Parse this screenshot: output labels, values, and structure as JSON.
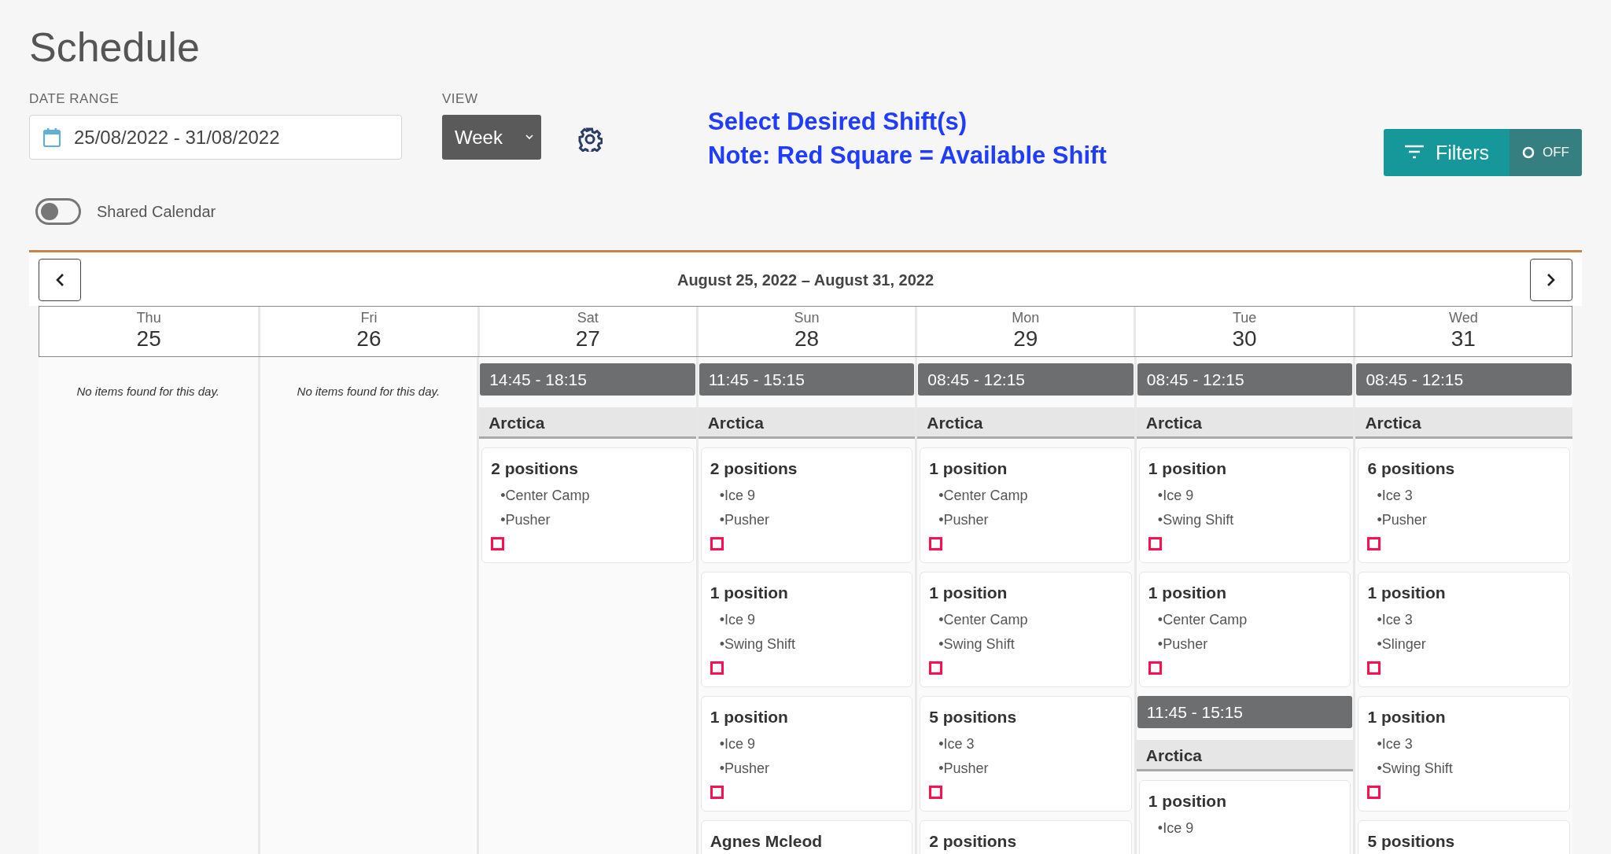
{
  "page": {
    "title": "Schedule"
  },
  "date_range": {
    "label": "DATE RANGE",
    "value": "25/08/2022 - 31/08/2022"
  },
  "view": {
    "label": "VIEW",
    "value": "Week"
  },
  "notice": [
    "Select Desired Shift(s)",
    "Note: Red Square = Available Shift"
  ],
  "filters": {
    "label": "Filters",
    "state_label": "OFF",
    "on": false
  },
  "shared_calendar": {
    "label": "Shared Calendar",
    "on": false
  },
  "calendar": {
    "range_title": "August 25, 2022 – August 31, 2022",
    "days": [
      {
        "weekday": "Thu",
        "date": "25",
        "empty_message": "No items found for this day."
      },
      {
        "weekday": "Fri",
        "date": "26",
        "empty_message": "No items found for this day."
      },
      {
        "weekday": "Sat",
        "date": "27",
        "blocks": [
          {
            "time": "14:45 - 18:15",
            "location": "Arctica",
            "cards": [
              {
                "title": "2 positions",
                "details": [
                  "•Center Camp",
                  "•Pusher"
                ],
                "checked": false
              }
            ]
          }
        ]
      },
      {
        "weekday": "Sun",
        "date": "28",
        "blocks": [
          {
            "time": "11:45 - 15:15",
            "location": "Arctica",
            "cards": [
              {
                "title": "2 positions",
                "details": [
                  "•Ice 9",
                  "•Pusher"
                ],
                "checked": false
              },
              {
                "title": "1 position",
                "details": [
                  "•Ice 9",
                  "•Swing Shift"
                ],
                "checked": false
              },
              {
                "title": "1 position",
                "details": [
                  "•Ice 9",
                  "•Pusher"
                ],
                "checked": false
              },
              {
                "title": "Agnes Mcleod"
              }
            ]
          }
        ]
      },
      {
        "weekday": "Mon",
        "date": "29",
        "blocks": [
          {
            "time": "08:45 - 12:15",
            "location": "Arctica",
            "cards": [
              {
                "title": "1 position",
                "details": [
                  "•Center Camp",
                  "•Pusher"
                ],
                "checked": false
              },
              {
                "title": "1 position",
                "details": [
                  "•Center Camp",
                  "•Swing Shift"
                ],
                "checked": false
              },
              {
                "title": "5 positions",
                "details": [
                  "•Ice 3",
                  "•Pusher"
                ],
                "checked": false
              },
              {
                "title": "2 positions"
              }
            ]
          }
        ]
      },
      {
        "weekday": "Tue",
        "date": "30",
        "blocks": [
          {
            "time": "08:45 - 12:15",
            "location": "Arctica",
            "cards": [
              {
                "title": "1 position",
                "details": [
                  "•Ice 9",
                  "•Swing Shift"
                ],
                "checked": false
              },
              {
                "title": "1 position",
                "details": [
                  "•Center Camp",
                  "•Pusher"
                ],
                "checked": false
              }
            ]
          },
          {
            "time": "11:45 - 15:15",
            "location": "Arctica",
            "cards": [
              {
                "title": "1 position",
                "details": [
                  "•Ice 9"
                ]
              }
            ]
          }
        ]
      },
      {
        "weekday": "Wed",
        "date": "31",
        "blocks": [
          {
            "time": "08:45 - 12:15",
            "location": "Arctica",
            "cards": [
              {
                "title": "6 positions",
                "details": [
                  "•Ice 3",
                  "•Pusher"
                ],
                "checked": false
              },
              {
                "title": "1 position",
                "details": [
                  "•Ice 3",
                  "•Slinger"
                ],
                "checked": false
              },
              {
                "title": "1 position",
                "details": [
                  "•Ice 3",
                  "•Swing Shift"
                ],
                "checked": false
              },
              {
                "title": "5 positions"
              }
            ]
          }
        ]
      }
    ]
  }
}
